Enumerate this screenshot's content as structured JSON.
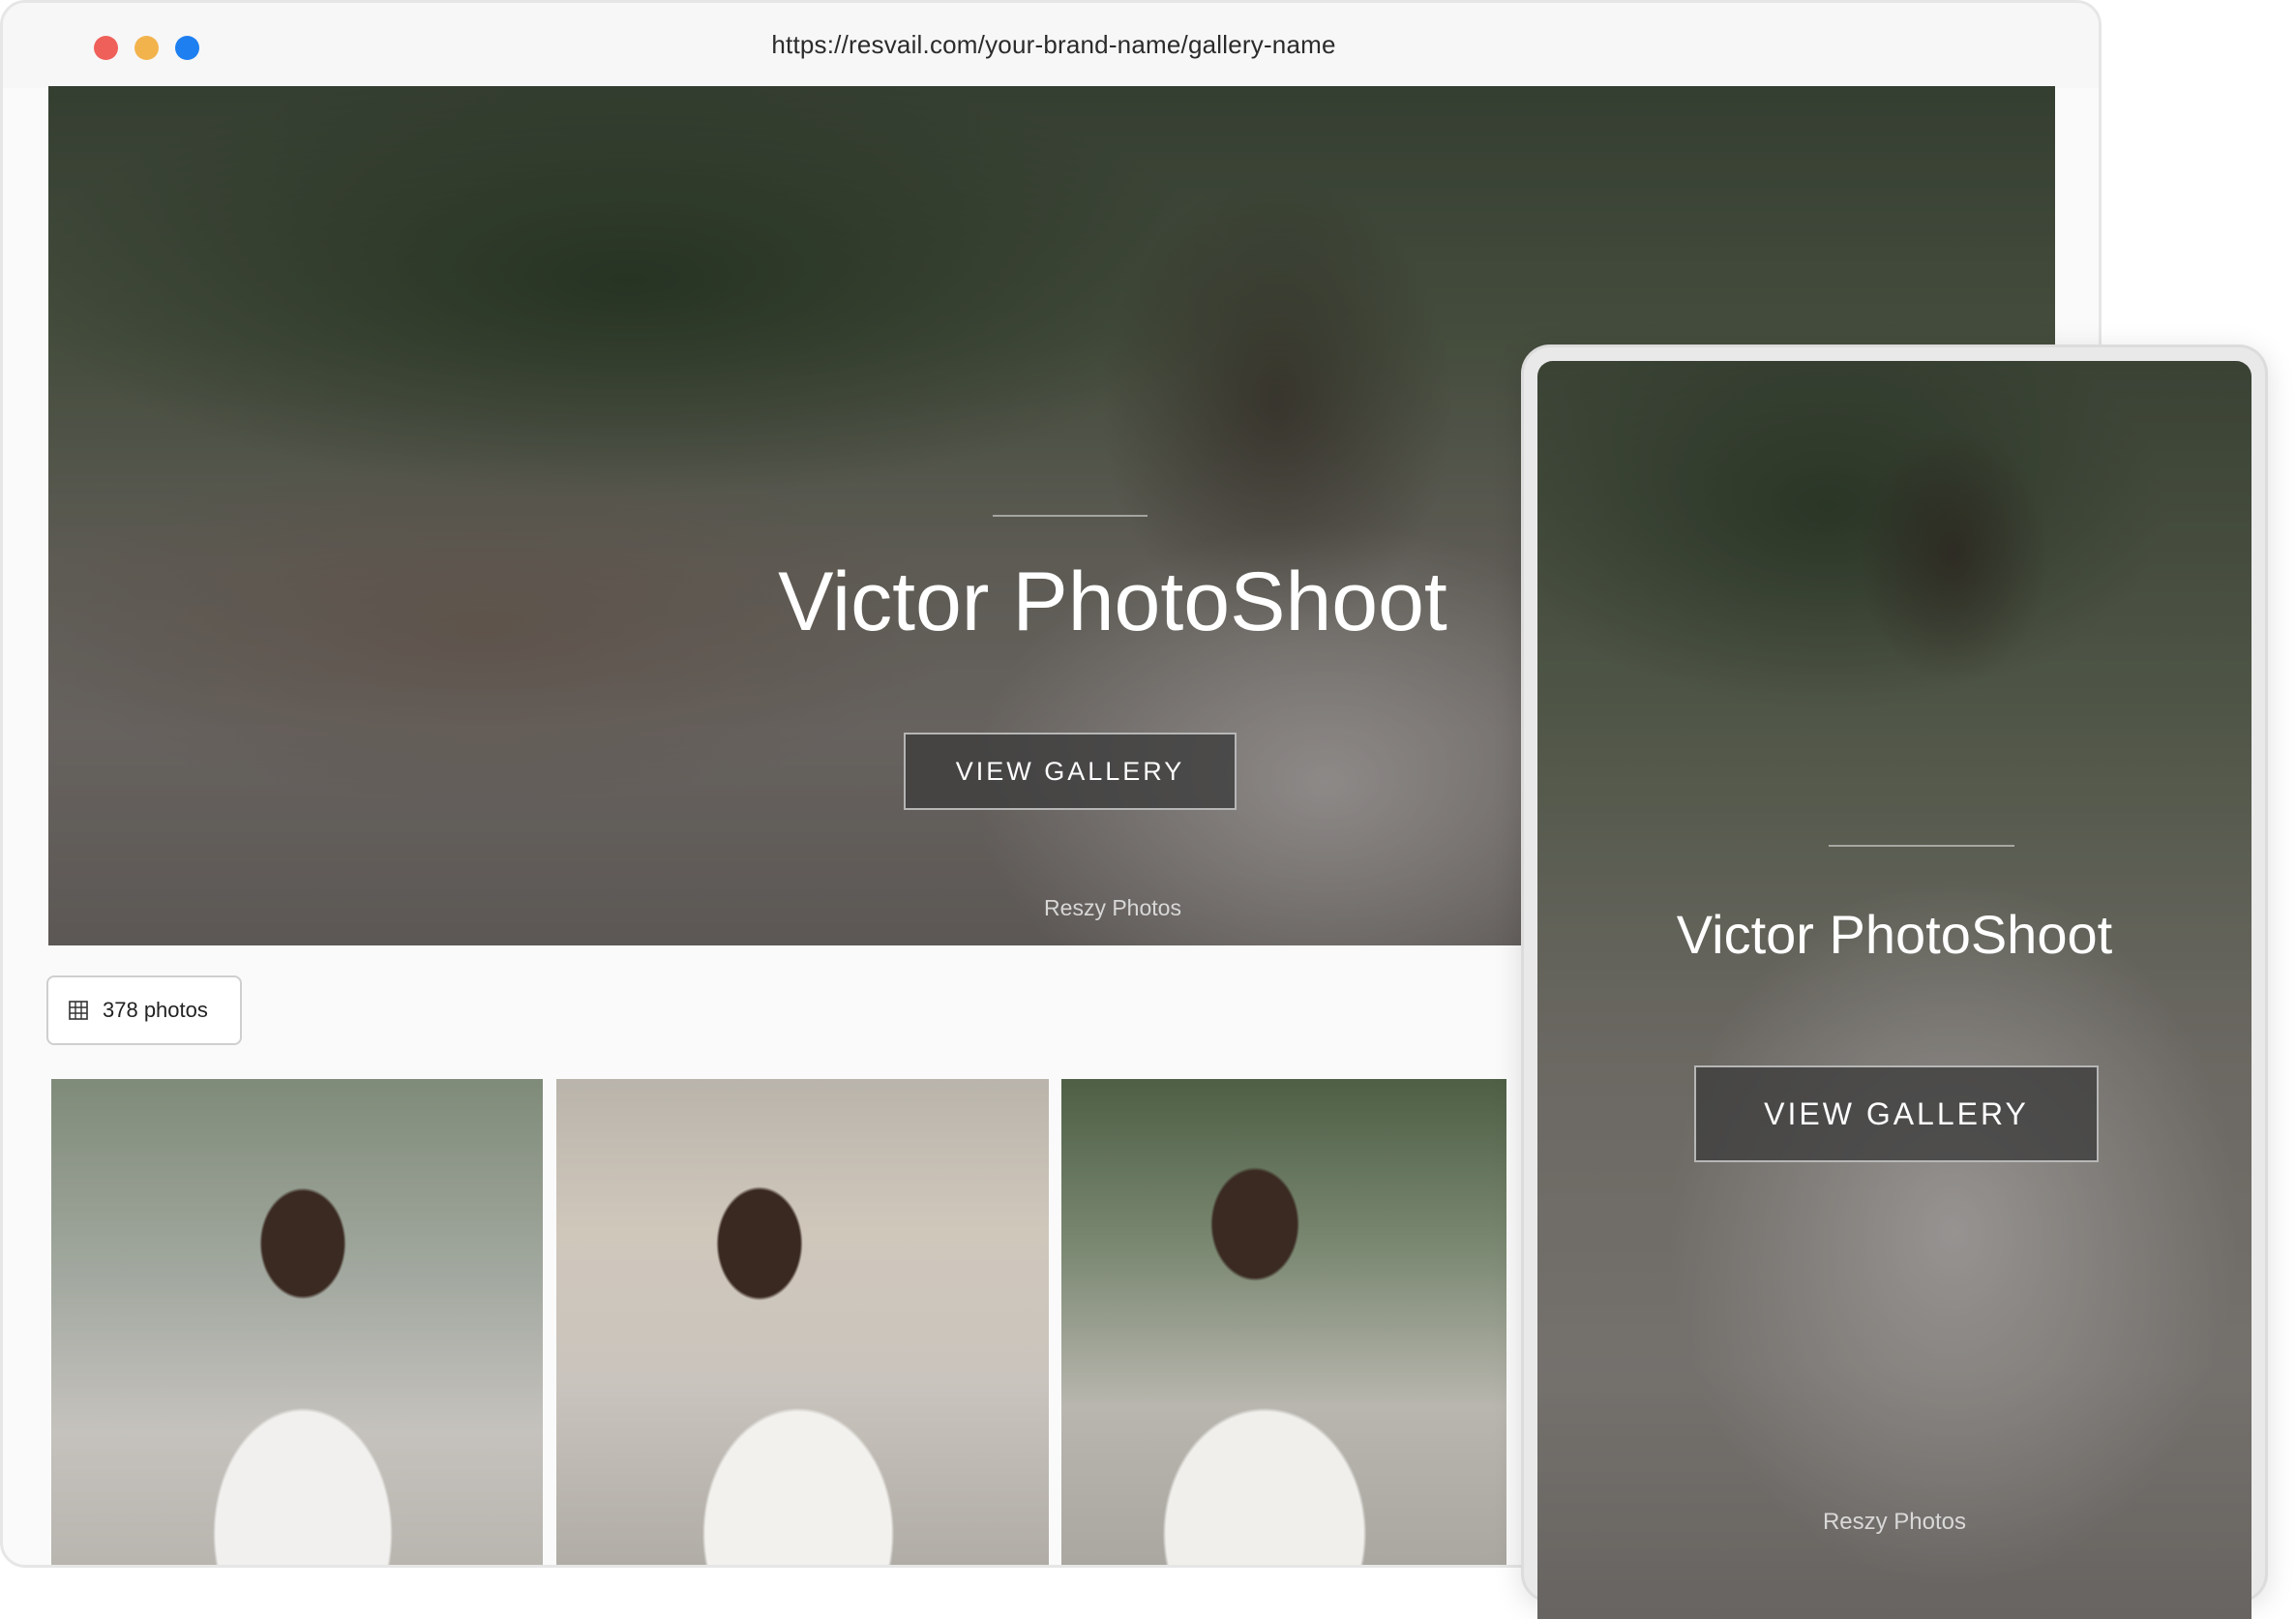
{
  "browser": {
    "url": "https://resvail.com/your-brand-name/gallery-name",
    "controls": [
      "close-dot",
      "minimize-dot",
      "zoom-dot"
    ]
  },
  "hero": {
    "title": "Victor PhotoShoot",
    "button_label": "VIEW GALLERY",
    "brand": "Reszy Photos"
  },
  "gallery": {
    "photo_count_label": "378 photos",
    "count_icon": "grid-icon",
    "thumbnails": [
      "photo-1",
      "photo-2",
      "photo-3"
    ]
  },
  "mobile": {
    "title": "Victor PhotoShoot",
    "button_label": "VIEW GALLERY",
    "brand": "Reszy Photos"
  },
  "colors": {
    "close": "#f0605a",
    "minimize": "#f3b34c",
    "zoom": "#1d7ff0",
    "button_bg": "#3c3c3c"
  }
}
